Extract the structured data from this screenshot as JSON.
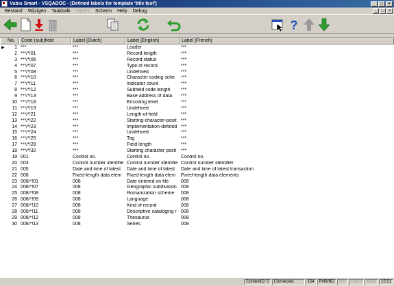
{
  "window": {
    "title": "Vubis Smart - VSQADOC - [Defined labels for template 'title test']",
    "minimize": "_",
    "maximize": "□",
    "close": "×"
  },
  "menu": {
    "items": [
      {
        "label": "Bestand",
        "enabled": true
      },
      {
        "label": "Wijzigen",
        "enabled": true
      },
      {
        "label": "Taakbalk",
        "enabled": true
      },
      {
        "label": "Opties",
        "enabled": false
      },
      {
        "label": "Scherm",
        "enabled": true
      },
      {
        "label": "Help",
        "enabled": true
      },
      {
        "label": "Debug",
        "enabled": true
      }
    ],
    "mdi": [
      "_",
      "□",
      "×"
    ]
  },
  "toolbar": {
    "icons": [
      "back-arrow-icon",
      "new-document-icon",
      "download-arrow-icon",
      "trash-icon",
      "copy-icon",
      "refresh-icon",
      "undo-icon",
      "window-select-icon",
      "help-icon",
      "up-arrow-icon",
      "down-arrow-icon"
    ],
    "colors": {
      "green": "#2e9e2e",
      "red": "#d01010",
      "blue": "#1f50c0",
      "gray": "#9a9a9a"
    }
  },
  "table": {
    "headers": [
      "No.",
      "Code (sub)field",
      "Label [Dutch]",
      "Label [English]",
      "Label [French]"
    ],
    "current_row": 1,
    "rows": [
      {
        "no": "1",
        "code": "***",
        "dutch": "***",
        "english": "Leader",
        "french": "***"
      },
      {
        "no": "2",
        "code": "***/*!01",
        "dutch": "***",
        "english": "Record length",
        "french": "***"
      },
      {
        "no": "3",
        "code": "***/*!06",
        "dutch": "***",
        "english": "Record status",
        "french": "***"
      },
      {
        "no": "4",
        "code": "***/*!07",
        "dutch": "***",
        "english": "Type of record",
        "french": "***"
      },
      {
        "no": "5",
        "code": "***/*!08",
        "dutch": "***",
        "english": "Undefined",
        "french": "***"
      },
      {
        "no": "6",
        "code": "***/*!10",
        "dutch": "***",
        "english": "Character coding sche",
        "french": "***"
      },
      {
        "no": "7",
        "code": "***/*!11",
        "dutch": "***",
        "english": "Indicator count",
        "french": "***"
      },
      {
        "no": "8",
        "code": "***/*!12",
        "dutch": "***",
        "english": "Subfield code length",
        "french": "***"
      },
      {
        "no": "9",
        "code": "***/*!13",
        "dutch": "***",
        "english": "Base address of data",
        "french": "***"
      },
      {
        "no": "10",
        "code": "***/*!18",
        "dutch": "***",
        "english": "Encoding level",
        "french": "***"
      },
      {
        "no": "11",
        "code": "***/*!19",
        "dutch": "***",
        "english": "Undefined",
        "french": "***"
      },
      {
        "no": "12",
        "code": "***/*!21",
        "dutch": "***",
        "english": "Length-of-field",
        "french": "***"
      },
      {
        "no": "13",
        "code": "***/*!22",
        "dutch": "***",
        "english": "Starting-character-posit",
        "french": "***"
      },
      {
        "no": "14",
        "code": "***/*!23",
        "dutch": "***",
        "english": "Implementation-defined",
        "french": "***"
      },
      {
        "no": "15",
        "code": "***/*!24",
        "dutch": "***",
        "english": "Undefined",
        "french": "***"
      },
      {
        "no": "16",
        "code": "***/*!25",
        "dutch": "***",
        "english": "Tag",
        "french": "***"
      },
      {
        "no": "17",
        "code": "***/*!28",
        "dutch": "***",
        "english": "Field length",
        "french": "***"
      },
      {
        "no": "18",
        "code": "***/*!32",
        "dutch": "***",
        "english": "Starting character posit",
        "french": "***"
      },
      {
        "no": "19",
        "code": "001",
        "dutch": "Control no.",
        "english": "Control no.",
        "french": "Control no."
      },
      {
        "no": "20",
        "code": "003",
        "dutch": "Control number identifie",
        "english": "Control number identifie",
        "french": "Control number identifier"
      },
      {
        "no": "21",
        "code": "005",
        "dutch": "Date and time of latest",
        "english": "Date and time of latest",
        "french": "Date and time of latest transaction"
      },
      {
        "no": "22",
        "code": "008",
        "dutch": "Fixed-length data elem",
        "english": "Fixed-length data elem",
        "french": "Fixed-length data elements"
      },
      {
        "no": "23",
        "code": "008/*!01",
        "dutch": "008",
        "english": "Date entered on file",
        "french": "008"
      },
      {
        "no": "24",
        "code": "008/*!07",
        "dutch": "008",
        "english": "Geographic subdivision",
        "french": "008"
      },
      {
        "no": "25",
        "code": "008/*!08",
        "dutch": "008",
        "english": "Romanization scheme",
        "french": "008"
      },
      {
        "no": "26",
        "code": "008/*!09",
        "dutch": "008",
        "english": "Language",
        "french": "008"
      },
      {
        "no": "27",
        "code": "008/*!10",
        "dutch": "008",
        "english": "Kind of record",
        "french": "008"
      },
      {
        "no": "28",
        "code": "008/*!11",
        "dutch": "008",
        "english": "Descriptive cataloging r",
        "french": "008"
      },
      {
        "no": "29",
        "code": "008/*!12",
        "dutch": "008",
        "english": "Thesaurus",
        "french": "008"
      },
      {
        "no": "30",
        "code": "008/*!13",
        "dutch": "008",
        "english": "Series",
        "french": "008"
      }
    ]
  },
  "statusbar": {
    "context": "ContextID: 0",
    "connection": "Connected",
    "number": "154",
    "db": "PNB/BD",
    "ins": "INS",
    "caps": "CAPS",
    "num": "NUM",
    "time": "15:51"
  }
}
